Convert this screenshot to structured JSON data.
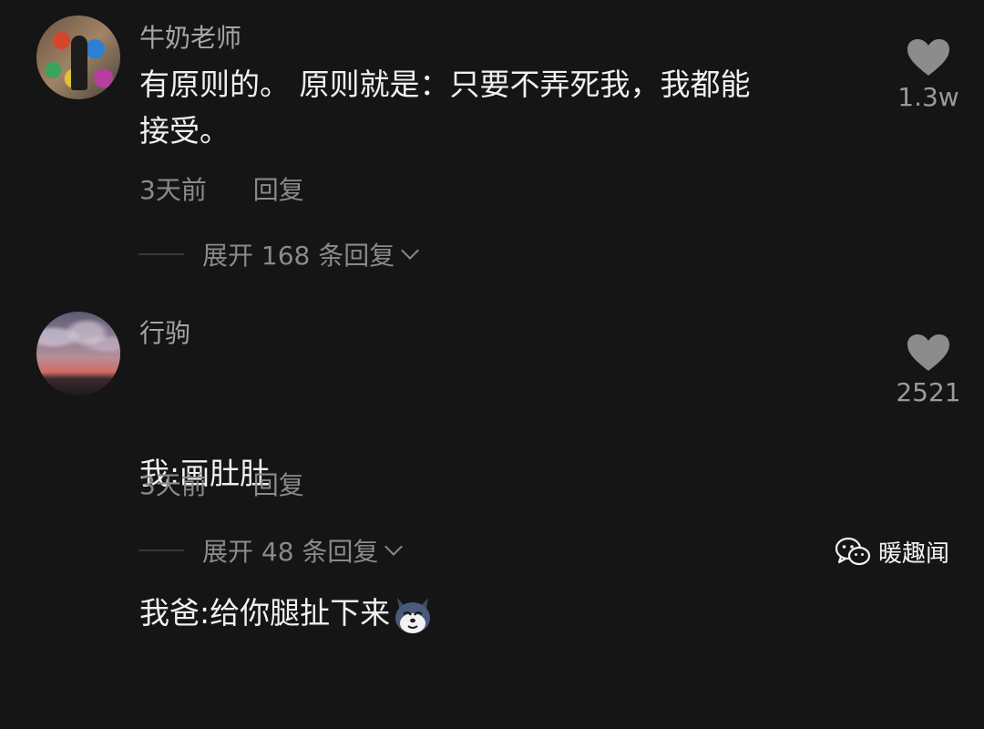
{
  "comments": [
    {
      "username": "牛奶老师",
      "text": "有原则的。 原则就是：只要不弄死我，我都能\n接受。",
      "time": "3天前",
      "reply_label": "回复",
      "expand_label": "展开 168 条回复",
      "likes": "1.3w",
      "avatar_icon": "avatar-graffiti-photo"
    },
    {
      "username": "行驹",
      "text_line1": "我:画肚肚",
      "text_line2": "我爸:给你腿扯下来",
      "emoji": "husky-dog-emoji",
      "time": "3天前",
      "reply_label": "回复",
      "expand_label": "展开 48 条回复",
      "likes": "2521",
      "avatar_icon": "avatar-sunset-sky-photo"
    }
  ],
  "watermark": {
    "text": "暖趣闻",
    "icon": "wechat-icon"
  },
  "colors": {
    "background": "#151515",
    "text": "#f0f0f0",
    "muted": "#8a8a8a"
  }
}
